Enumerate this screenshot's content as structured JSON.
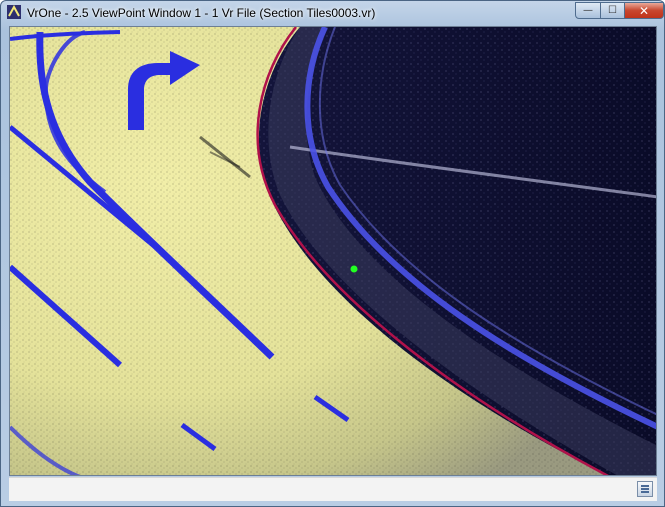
{
  "window": {
    "title": "VrOne - 2.5 ViewPoint Window 1 - 1 Vr File  (Section Tiles0003.vr)",
    "minimize_glyph": "—",
    "maximize_glyph": "☐",
    "close_glyph": "✕"
  },
  "viewport": {
    "content": "point-cloud road scene",
    "colors": {
      "ground": "#e8e6a0",
      "dark_area": "#0c0c2e",
      "lane_marking": "#2a2ee0",
      "selected_line": "#b0124a",
      "cursor_point": "#22ff22"
    }
  },
  "statusbar": {
    "icon": "status-panel-icon"
  }
}
